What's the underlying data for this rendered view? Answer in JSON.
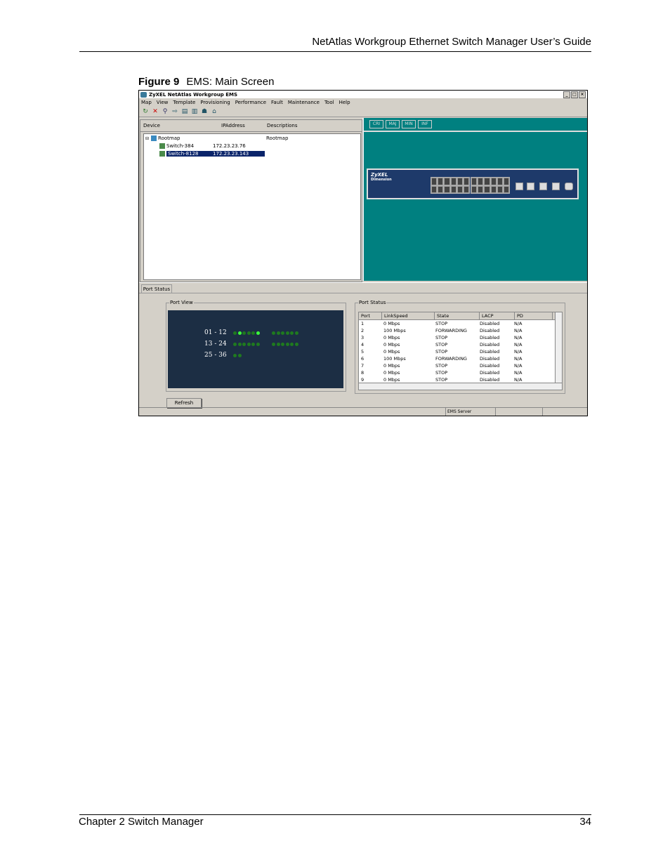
{
  "page": {
    "header": "NetAtlas Workgroup Ethernet Switch Manager User’s Guide",
    "figure_label": "Figure 9",
    "figure_title": "EMS: Main Screen",
    "footer_left": "Chapter 2 Switch Manager",
    "footer_right": "34"
  },
  "window": {
    "title": "ZyXEL NetAtlas Workgroup EMS",
    "menu": [
      "Map",
      "View",
      "Template",
      "Provisioning",
      "Performance",
      "Fault",
      "Maintenance",
      "Tool",
      "Help"
    ],
    "tree_headers": [
      "Device",
      "IPAddress",
      "Descriptions"
    ],
    "tree": {
      "root": {
        "name": "Rootmap",
        "description": "Rootmap"
      },
      "children": [
        {
          "name": "Switch-384",
          "ip": "172.23.23.76"
        },
        {
          "name": "Switch-8128",
          "ip": "172.23.23.143"
        }
      ]
    },
    "alarm_buttons": [
      "CRI",
      "MAJ",
      "MIN",
      "INF"
    ],
    "device_brand": "ZyXEL",
    "device_model": "Dimension",
    "tab": "Port Status",
    "port_view_label": "Port View",
    "port_view_rows": [
      {
        "label": "01 - 12",
        "leds": [
          0,
          1,
          0,
          0,
          0,
          1,
          0,
          0,
          0,
          0,
          0,
          0
        ]
      },
      {
        "label": "13 - 24",
        "leds": [
          0,
          0,
          0,
          0,
          0,
          0,
          0,
          0,
          0,
          0,
          0,
          0
        ]
      },
      {
        "label": "25 - 36",
        "leds": [
          0,
          0
        ]
      }
    ],
    "port_status_label": "Port Status",
    "columns": [
      "Port",
      "LinkSpeed",
      "State",
      "LACP",
      "PD"
    ],
    "rows": [
      [
        "1",
        "0 Mbps",
        "STOP",
        "Disabled",
        "N/A"
      ],
      [
        "2",
        "100 Mbps",
        "FORWARDING",
        "Disabled",
        "N/A"
      ],
      [
        "3",
        "0 Mbps",
        "STOP",
        "Disabled",
        "N/A"
      ],
      [
        "4",
        "0 Mbps",
        "STOP",
        "Disabled",
        "N/A"
      ],
      [
        "5",
        "0 Mbps",
        "STOP",
        "Disabled",
        "N/A"
      ],
      [
        "6",
        "100 Mbps",
        "FORWARDING",
        "Disabled",
        "N/A"
      ],
      [
        "7",
        "0 Mbps",
        "STOP",
        "Disabled",
        "N/A"
      ],
      [
        "8",
        "0 Mbps",
        "STOP",
        "Disabled",
        "N/A"
      ],
      [
        "9",
        "0 Mbps",
        "STOP",
        "Disabled",
        "N/A"
      ]
    ],
    "refresh_label": "Refresh",
    "status_text": "EMS Server"
  }
}
